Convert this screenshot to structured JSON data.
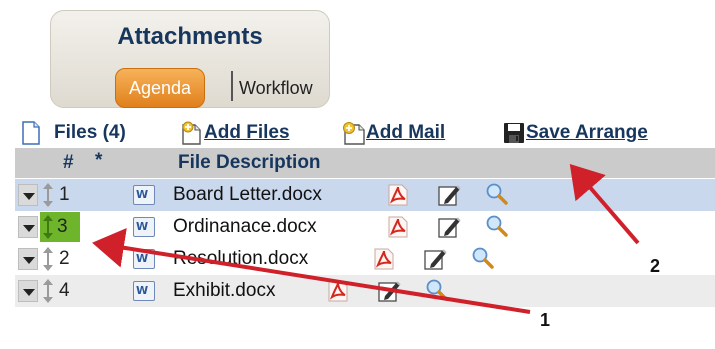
{
  "panel": {
    "title": "Attachments",
    "tabs": {
      "agenda": "Agenda",
      "separator": "|",
      "workflow": "Workflow"
    }
  },
  "toolbar": {
    "files_label": "Files (4)",
    "add_files": "Add Files",
    "add_mail": "Add Mail",
    "save_arrange": "Save Arrange"
  },
  "grid": {
    "headers": {
      "number": "#",
      "star": "*",
      "description": "File Description"
    },
    "rows": [
      {
        "number": "1",
        "name": "Board Letter.docx",
        "state": "selected"
      },
      {
        "number": "3",
        "name": "Ordinanace.docx",
        "state": "moved"
      },
      {
        "number": "2",
        "name": "Resolution.docx",
        "state": "normal"
      },
      {
        "number": "4",
        "name": "Exhibit.docx",
        "state": "normal"
      }
    ],
    "word_icon_text": "W"
  },
  "annotations": {
    "callout1": "1",
    "callout2": "2"
  },
  "colors": {
    "accent": "#e0801c",
    "link": "#17365d",
    "arrow": "#d0202a",
    "moved_highlight": "#6fb52c",
    "selected_row": "#c9d8ec"
  }
}
